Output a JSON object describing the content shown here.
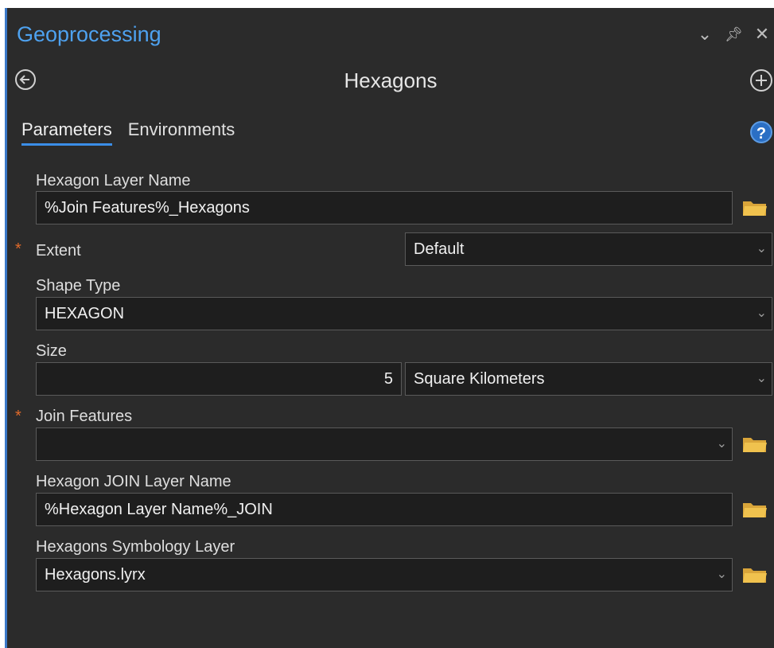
{
  "pane": {
    "title": "Geoprocessing",
    "tool_title": "Hexagons",
    "controls": {
      "collapse": "⌄",
      "pin": "ꟷ",
      "close": "✕"
    }
  },
  "tabs": [
    {
      "label": "Parameters",
      "active": true
    },
    {
      "label": "Environments",
      "active": false
    }
  ],
  "help_label": "?",
  "params": {
    "hexagon_layer_name": {
      "label": "Hexagon Layer Name",
      "value": "%Join Features%_Hexagons"
    },
    "extent": {
      "label": "Extent",
      "value": "Default",
      "required": true
    },
    "shape_type": {
      "label": "Shape Type",
      "value": "HEXAGON"
    },
    "size": {
      "label": "Size",
      "value": "5",
      "unit": "Square Kilometers"
    },
    "join_features": {
      "label": "Join Features",
      "value": "",
      "required": true
    },
    "hexagon_join_layer_name": {
      "label": "Hexagon JOIN Layer Name",
      "value": "%Hexagon Layer Name%_JOIN"
    },
    "symbology_layer": {
      "label": "Hexagons Symbology Layer",
      "value": "Hexagons.lyrx"
    }
  },
  "required_marker": "*",
  "colors": {
    "accent": "#4ea2f0",
    "panel": "#2b2b2b",
    "field": "#1e1e1e",
    "required": "#e06a2a",
    "folder": "#e8b84a"
  }
}
